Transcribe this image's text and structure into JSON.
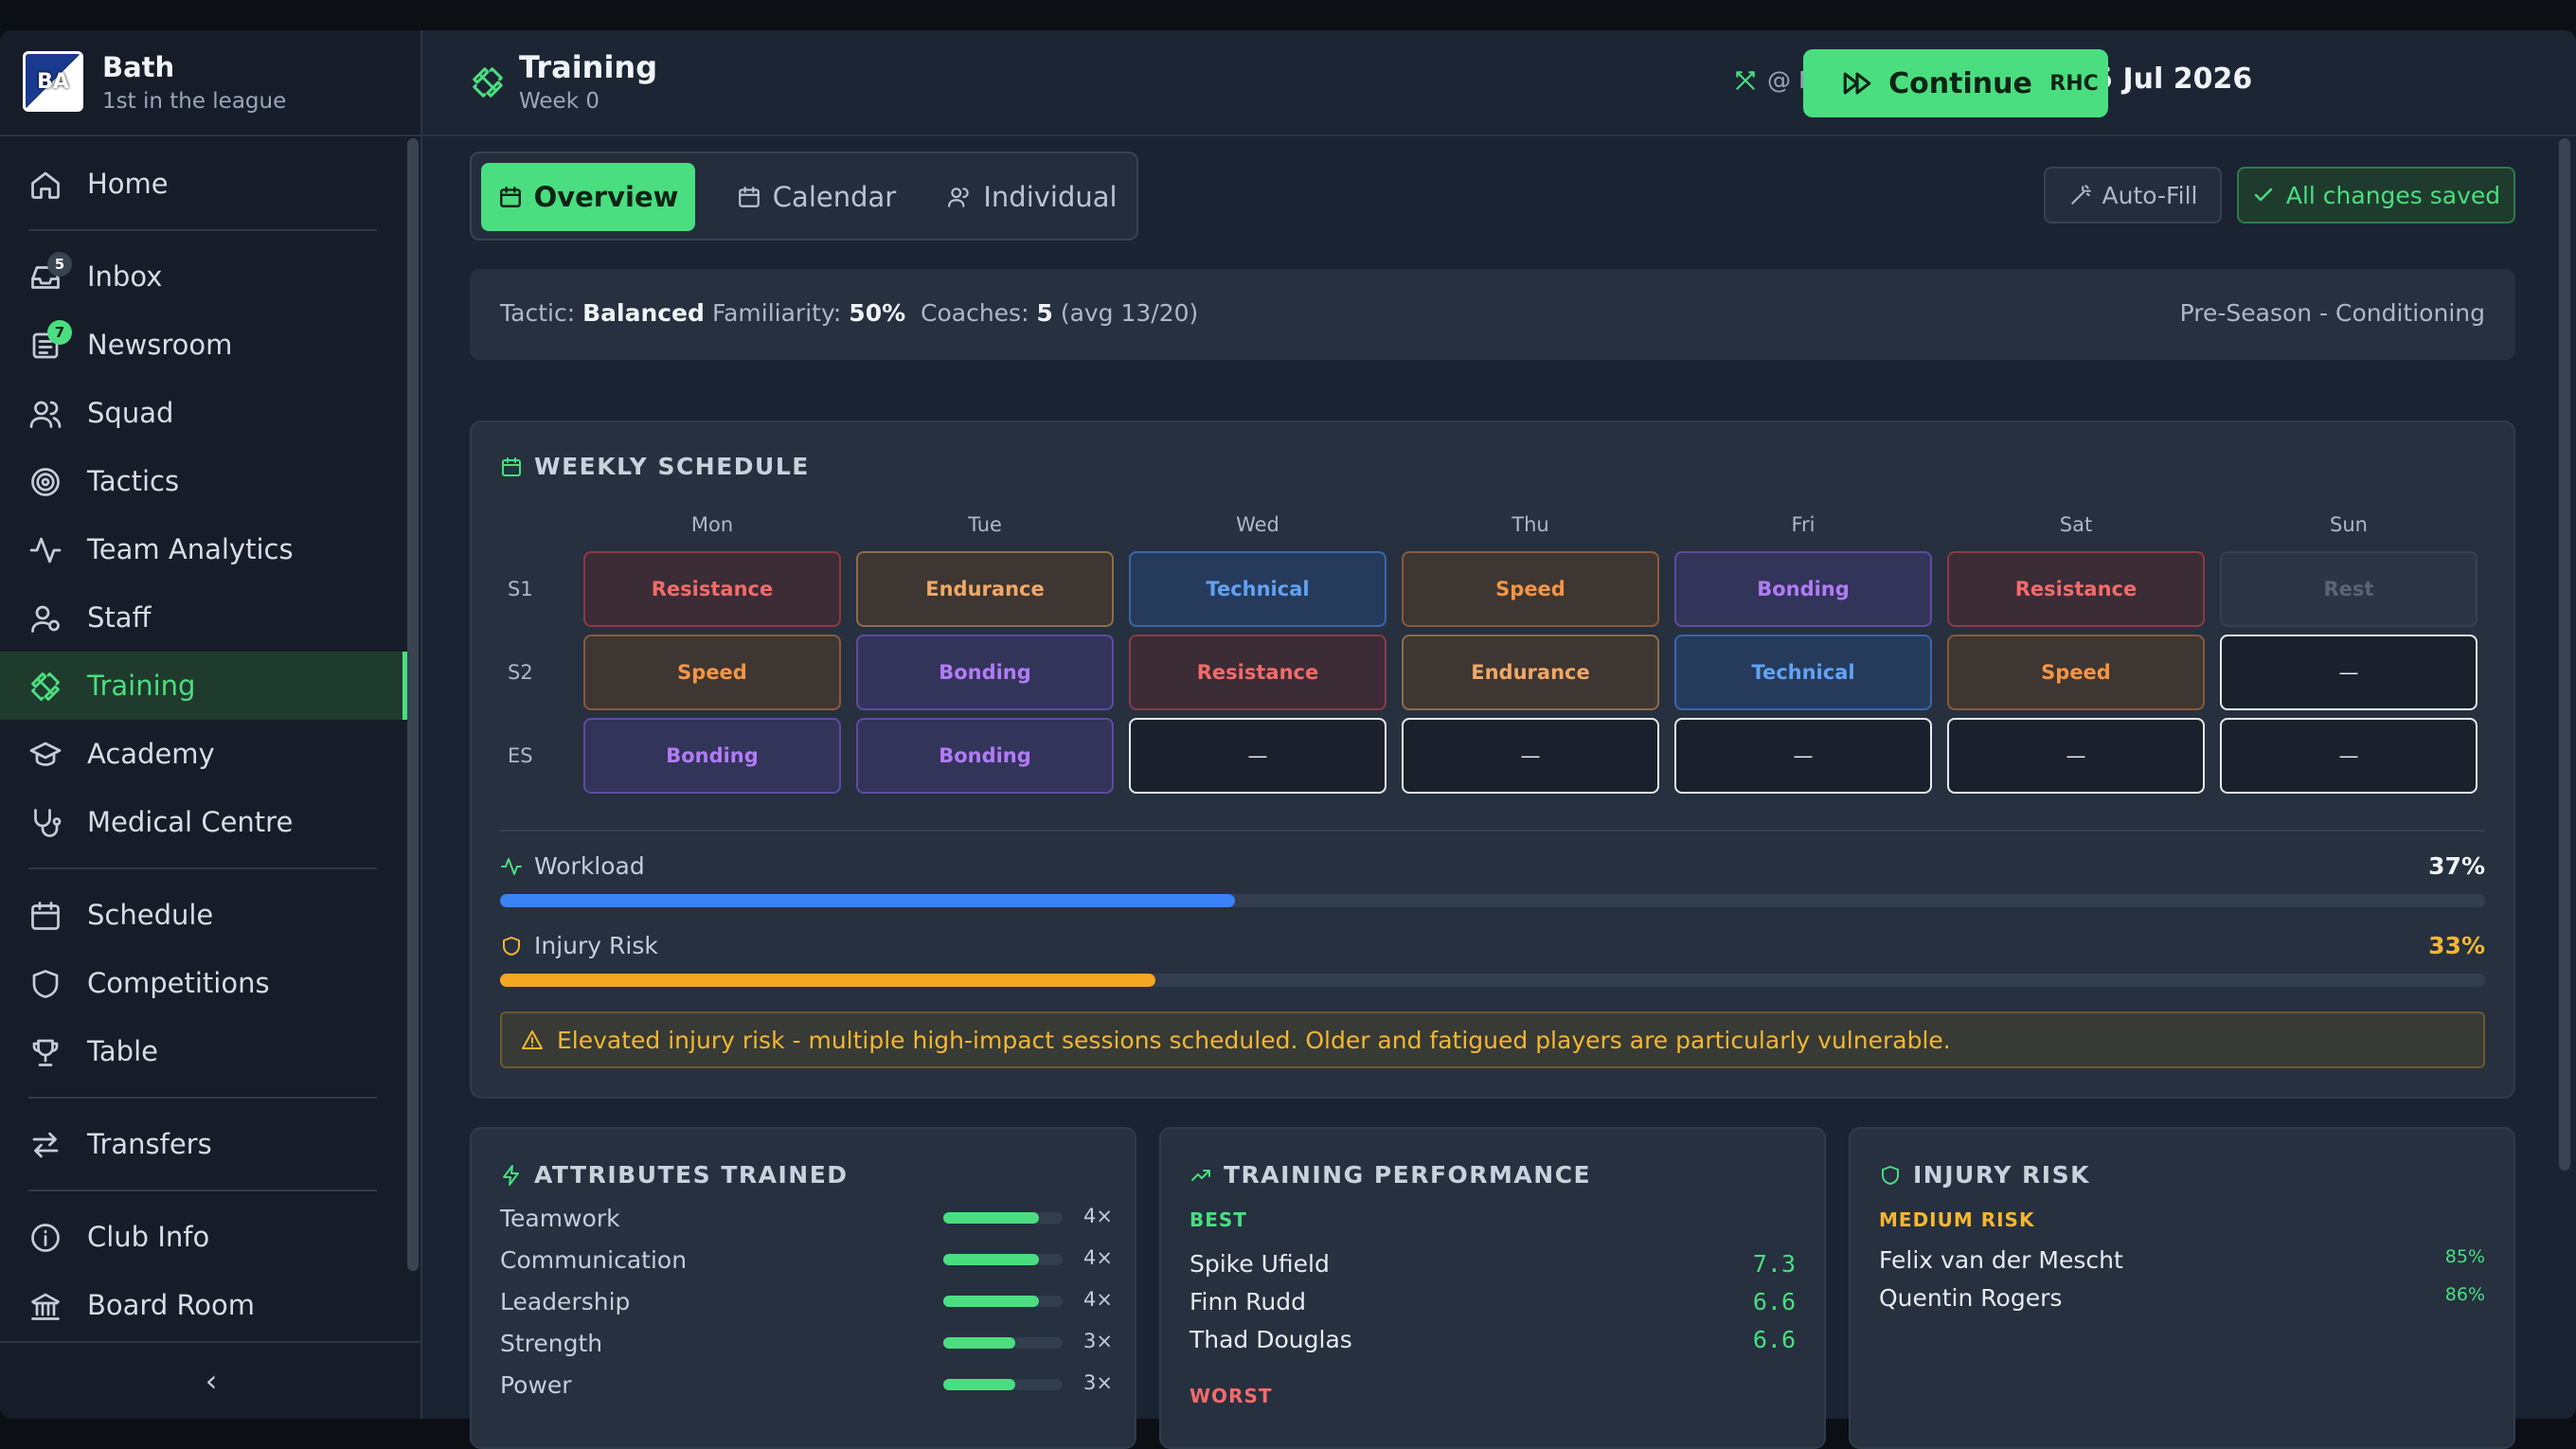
{
  "club": {
    "logo_text": "BA",
    "name": "Bath",
    "subtitle": "1st in the league"
  },
  "nav": {
    "home": "Home",
    "inbox": "Inbox",
    "inbox_badge": "5",
    "newsroom": "Newsroom",
    "newsroom_badge": "7",
    "squad": "Squad",
    "tactics": "Tactics",
    "team_analytics": "Team Analytics",
    "staff": "Staff",
    "training": "Training",
    "academy": "Academy",
    "medical": "Medical Centre",
    "schedule": "Schedule",
    "competitions": "Competitions",
    "table": "Table",
    "transfers": "Transfers",
    "club_info": "Club Info",
    "board_room": "Board Room",
    "collapse": "‹"
  },
  "header": {
    "title": "Training",
    "subtitle": "Week 0",
    "venue": "@ North London",
    "date": "Sun, 5 Jul 2026",
    "continue": "Continue",
    "avatar": "RHC"
  },
  "tabs": {
    "overview": "Overview",
    "calendar": "Calendar",
    "individual": "Individual"
  },
  "actions": {
    "autofill": "Auto-Fill",
    "saved": "All changes saved"
  },
  "info": {
    "tactic_label": "Tactic:",
    "tactic_value": "Balanced",
    "familiarity_label": "Familiarity:",
    "familiarity_value": "50%",
    "coaches_label": "Coaches:",
    "coaches_value": "5",
    "coaches_avg": "(avg 13/20)",
    "phase": "Pre-Season - Conditioning"
  },
  "schedule": {
    "title": "WEEKLY SCHEDULE",
    "days": [
      "Mon",
      "Tue",
      "Wed",
      "Thu",
      "Fri",
      "Sat",
      "Sun"
    ],
    "rows": [
      {
        "label": "S1",
        "cells": [
          "Resistance",
          "Endurance",
          "Technical",
          "Speed",
          "Bonding",
          "Resistance",
          "Rest"
        ]
      },
      {
        "label": "S2",
        "cells": [
          "Speed",
          "Bonding",
          "Resistance",
          "Endurance",
          "Technical",
          "Speed",
          "—"
        ]
      },
      {
        "label": "ES",
        "cells": [
          "Bonding",
          "Bonding",
          "—",
          "—",
          "—",
          "—",
          "—"
        ]
      }
    ]
  },
  "workload": {
    "label": "Workload",
    "value_text": "37%",
    "fill_fraction": 0.37,
    "color": "#3b82f6"
  },
  "injury_meter": {
    "label": "Injury Risk",
    "value_text": "33%",
    "fill_fraction": 0.33,
    "color": "#f5a623"
  },
  "alert": "Elevated injury risk - multiple high-impact sessions scheduled. Older and fatigued players are particularly vulnerable.",
  "attributes": {
    "title": "ATTRIBUTES TRAINED",
    "items": [
      {
        "name": "Teamwork",
        "count": "4×",
        "level": 0.8
      },
      {
        "name": "Communication",
        "count": "4×",
        "level": 0.8
      },
      {
        "name": "Leadership",
        "count": "4×",
        "level": 0.8
      },
      {
        "name": "Strength",
        "count": "3×",
        "level": 0.6
      },
      {
        "name": "Power",
        "count": "3×",
        "level": 0.6
      }
    ]
  },
  "performance": {
    "title": "TRAINING PERFORMANCE",
    "best_label": "BEST",
    "best": [
      {
        "name": "Spike Ufield",
        "score": "7.3"
      },
      {
        "name": "Finn Rudd",
        "score": "6.6"
      },
      {
        "name": "Thad Douglas",
        "score": "6.6"
      }
    ],
    "worst_label": "WORST"
  },
  "injury_card": {
    "title": "INJURY RISK",
    "level_label": "MEDIUM RISK",
    "players": [
      {
        "name": "Felix van der Mescht",
        "value": "85%"
      },
      {
        "name": "Quentin Rogers",
        "value": "86%"
      }
    ]
  },
  "colors": {
    "accent": "#4ade80",
    "warning": "#f5b731",
    "danger": "#f26b6b",
    "blue": "#3b82f6"
  }
}
